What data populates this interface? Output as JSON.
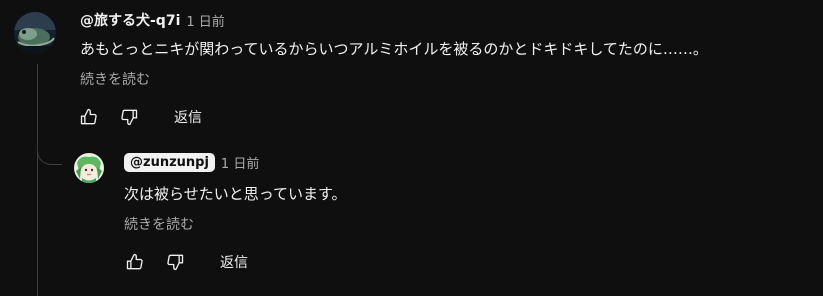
{
  "comment": {
    "author": "@旅する犬-q7i",
    "time": "1 日前",
    "text": "あもとっとニキが関わっているからいつアルミホイルを被るのかとドキドキしてたのに……。",
    "read_more": "続きを読む",
    "reply_label": "返信",
    "avatar_icon": "lizard-avatar-icon"
  },
  "reply": {
    "author": "@zunzunpj",
    "time": "1 日前",
    "text": "次は被らせたいと思っています。",
    "read_more": "続きを読む",
    "reply_label": "返信",
    "avatar_icon": "green-character-avatar-icon"
  },
  "icons": {
    "like": "thumbs-up-icon",
    "dislike": "thumbs-down-icon"
  },
  "colors": {
    "background": "#0f0f0f",
    "text": "#f1f1f1",
    "secondary_text": "#aaaaaa",
    "thread_line": "#3f3f3f"
  }
}
